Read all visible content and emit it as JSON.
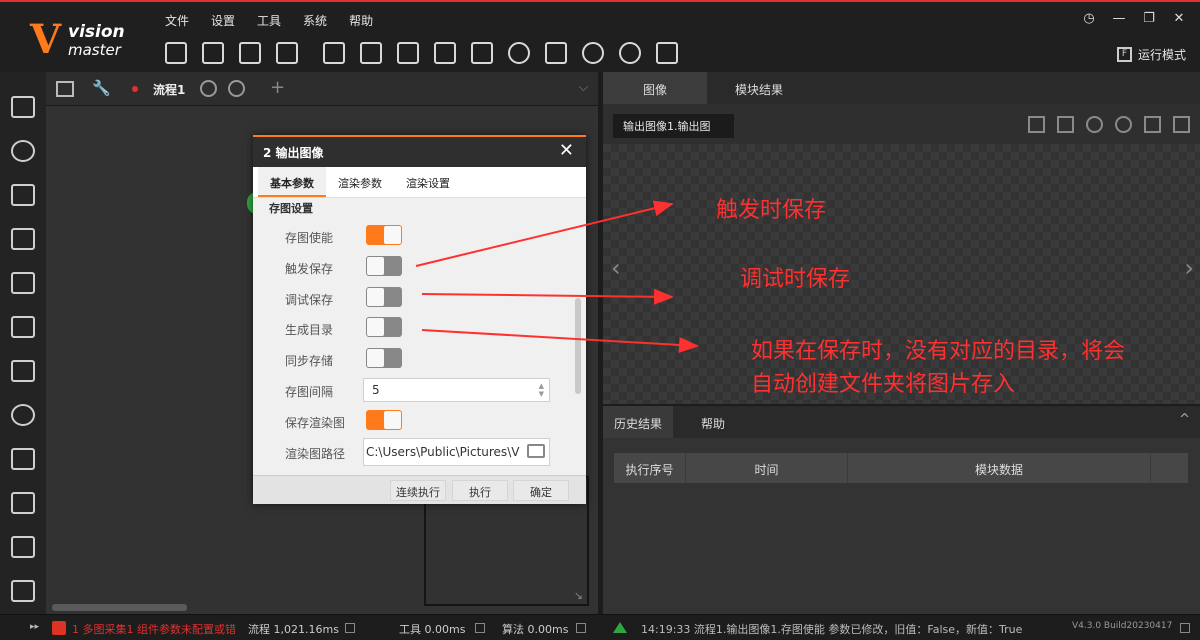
{
  "app": {
    "logo_letter": "V",
    "logo_top": "vision",
    "logo_bottom": "master"
  },
  "menu": [
    "文件",
    "设置",
    "工具",
    "系统",
    "帮助"
  ],
  "toolbar_icons": [
    "save-icon",
    "open-folder-icon",
    "undo-icon",
    "redo-icon",
    "lock-icon",
    "camera-icon",
    "controller-icon",
    "variable-icon",
    "display-icon",
    "loop-icon",
    "script-icon",
    "run-once-icon",
    "run-loop-icon",
    "report-icon"
  ],
  "window_controls": [
    "clock-icon",
    "minimize-icon",
    "restore-icon",
    "close-icon"
  ],
  "run_mode": {
    "icon": "F",
    "label": "运行模式"
  },
  "flow": {
    "name": "流程1",
    "plus": "+",
    "chevron": "⌵"
  },
  "dialog": {
    "title": "2 输出图像",
    "close": "✕",
    "tabs": [
      "基本参数",
      "渲染参数",
      "渲染设置"
    ],
    "section": "存图设置",
    "rows": [
      {
        "label": "存图使能",
        "toggle": true
      },
      {
        "label": "触发保存",
        "toggle": false
      },
      {
        "label": "调试保存",
        "toggle": false
      },
      {
        "label": "生成目录",
        "toggle": false
      },
      {
        "label": "同步存储",
        "toggle": false
      },
      {
        "label": "存图间隔",
        "value": "5"
      },
      {
        "label": "保存渲染图",
        "toggle": true
      },
      {
        "label": "渲染图路径",
        "value": "C:\\Users\\Public\\Pictures\\V"
      }
    ],
    "buttons": {
      "continuous": "连续执行",
      "execute": "执行",
      "confirm": "确定"
    }
  },
  "image_panel": {
    "tabs": [
      "图像",
      "模块结果"
    ],
    "selected_image": "输出图像1.输出图",
    "tools": [
      "layout-icon",
      "fit-icon",
      "zoom-in-icon",
      "zoom-out-icon",
      "actual-size-icon",
      "fullscreen-icon"
    ],
    "nav_left": "‹",
    "nav_right": "›"
  },
  "history": {
    "tabs": [
      "历史结果",
      "帮助"
    ],
    "collapse": "^",
    "columns": [
      "执行序号",
      "时间",
      "模块数据"
    ]
  },
  "annotations": {
    "a1": "触发时保存",
    "a2": "调试时保存",
    "a3_line1": "如果在保存时，没有对应的目录，将会",
    "a3_line2": "自动创建文件夹将图片存入"
  },
  "status": {
    "expand": "▸▸",
    "error": "1 多图采集1 组件参数未配置或错",
    "flow_time": "流程  1,021.16ms",
    "tool_time": "工具  0.00ms",
    "algo_time": "算法  0.00ms",
    "log": "14:19:33  流程1.输出图像1.存图使能 参数已修改，旧值：False，新值：True",
    "version": "V4.3.0 Build20230417"
  },
  "colors": {
    "accent": "#ff7a1a",
    "annotation": "#ff3030",
    "ok": "#2fa640",
    "error": "#e03030"
  }
}
